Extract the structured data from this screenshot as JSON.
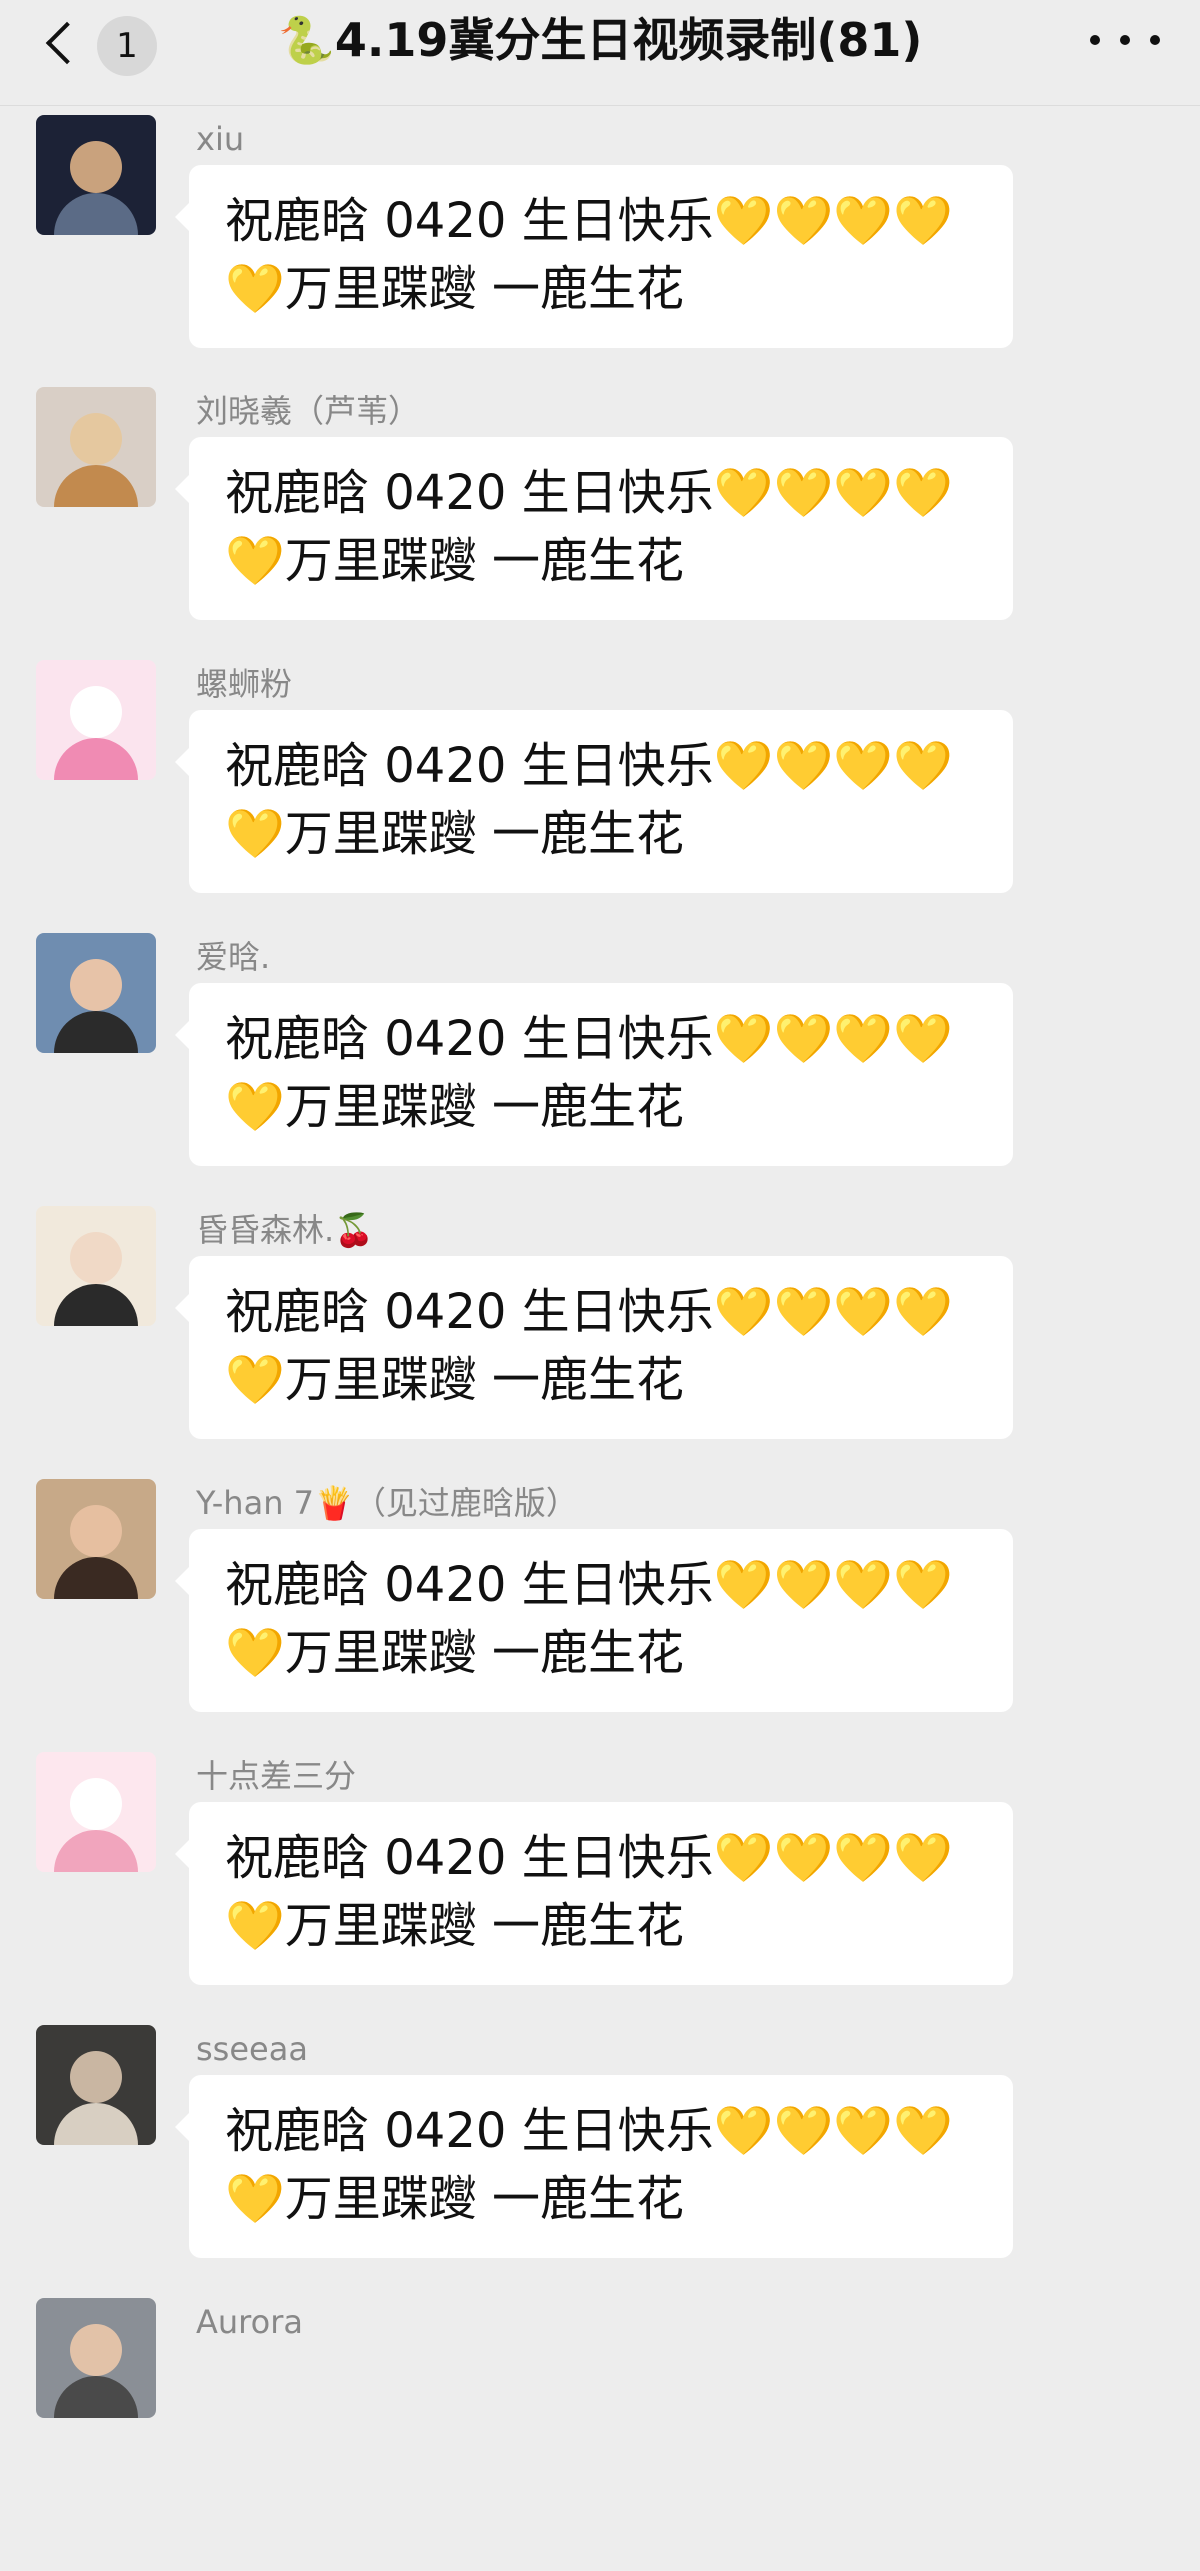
{
  "header": {
    "back_label": "返回",
    "unread_count": "1",
    "title": "🐍4.19冀分生日视频录制(81)",
    "more_icon": "more-dots-icon"
  },
  "messages": [
    {
      "sender": "xiu",
      "text": "祝鹿晗 0420 生日快乐💛💛💛💛💛万里蹀躞  一鹿生花",
      "avatar_colors": [
        "#1c2236",
        "#5b6b86",
        "#c9a27d"
      ]
    },
    {
      "sender": "刘晓羲（芦苇）",
      "text": "祝鹿晗 0420 生日快乐💛💛💛💛💛万里蹀躞  一鹿生花",
      "avatar_colors": [
        "#d9cfc6",
        "#c28a4e",
        "#e5c89f"
      ]
    },
    {
      "sender": "螺蛳粉",
      "text": "祝鹿晗 0420 生日快乐💛💛💛💛💛万里蹀躞  一鹿生花",
      "avatar_colors": [
        "#fbe4ee",
        "#f08bb3",
        "#ffffff"
      ]
    },
    {
      "sender": "爱晗.",
      "text": "祝鹿晗 0420 生日快乐💛💛💛💛💛万里蹀躞  一鹿生花",
      "avatar_colors": [
        "#6f8db0",
        "#2b2b2b",
        "#e7c3a8"
      ]
    },
    {
      "sender": "昏昏森林.🍒",
      "text": "祝鹿晗 0420 生日快乐💛💛💛💛💛万里蹀躞  一鹿生花",
      "avatar_colors": [
        "#f1e9dc",
        "#2a2a2a",
        "#f0d9c6"
      ]
    },
    {
      "sender": "Y-han 7🍟（见过鹿晗版）",
      "text": "祝鹿晗 0420 生日快乐💛💛💛💛💛万里蹀躞  一鹿生花",
      "avatar_colors": [
        "#c7a988",
        "#3a2a22",
        "#e6bfa0"
      ]
    },
    {
      "sender": "十点差三分",
      "text": "祝鹿晗 0420 生日快乐💛💛💛💛💛万里蹀躞  一鹿生花",
      "avatar_colors": [
        "#fde7ee",
        "#f1a5bd",
        "#ffffff"
      ]
    },
    {
      "sender": "sseeaa",
      "text": "祝鹿晗 0420 生日快乐💛💛💛💛💛万里蹀躞  一鹿生花",
      "avatar_colors": [
        "#3b3a38",
        "#d8cfc2",
        "#c9b6a2"
      ]
    },
    {
      "sender": "Aurora",
      "text": "",
      "avatar_colors": [
        "#8a8f96",
        "#4a4a4a",
        "#e2c2a8"
      ]
    }
  ]
}
